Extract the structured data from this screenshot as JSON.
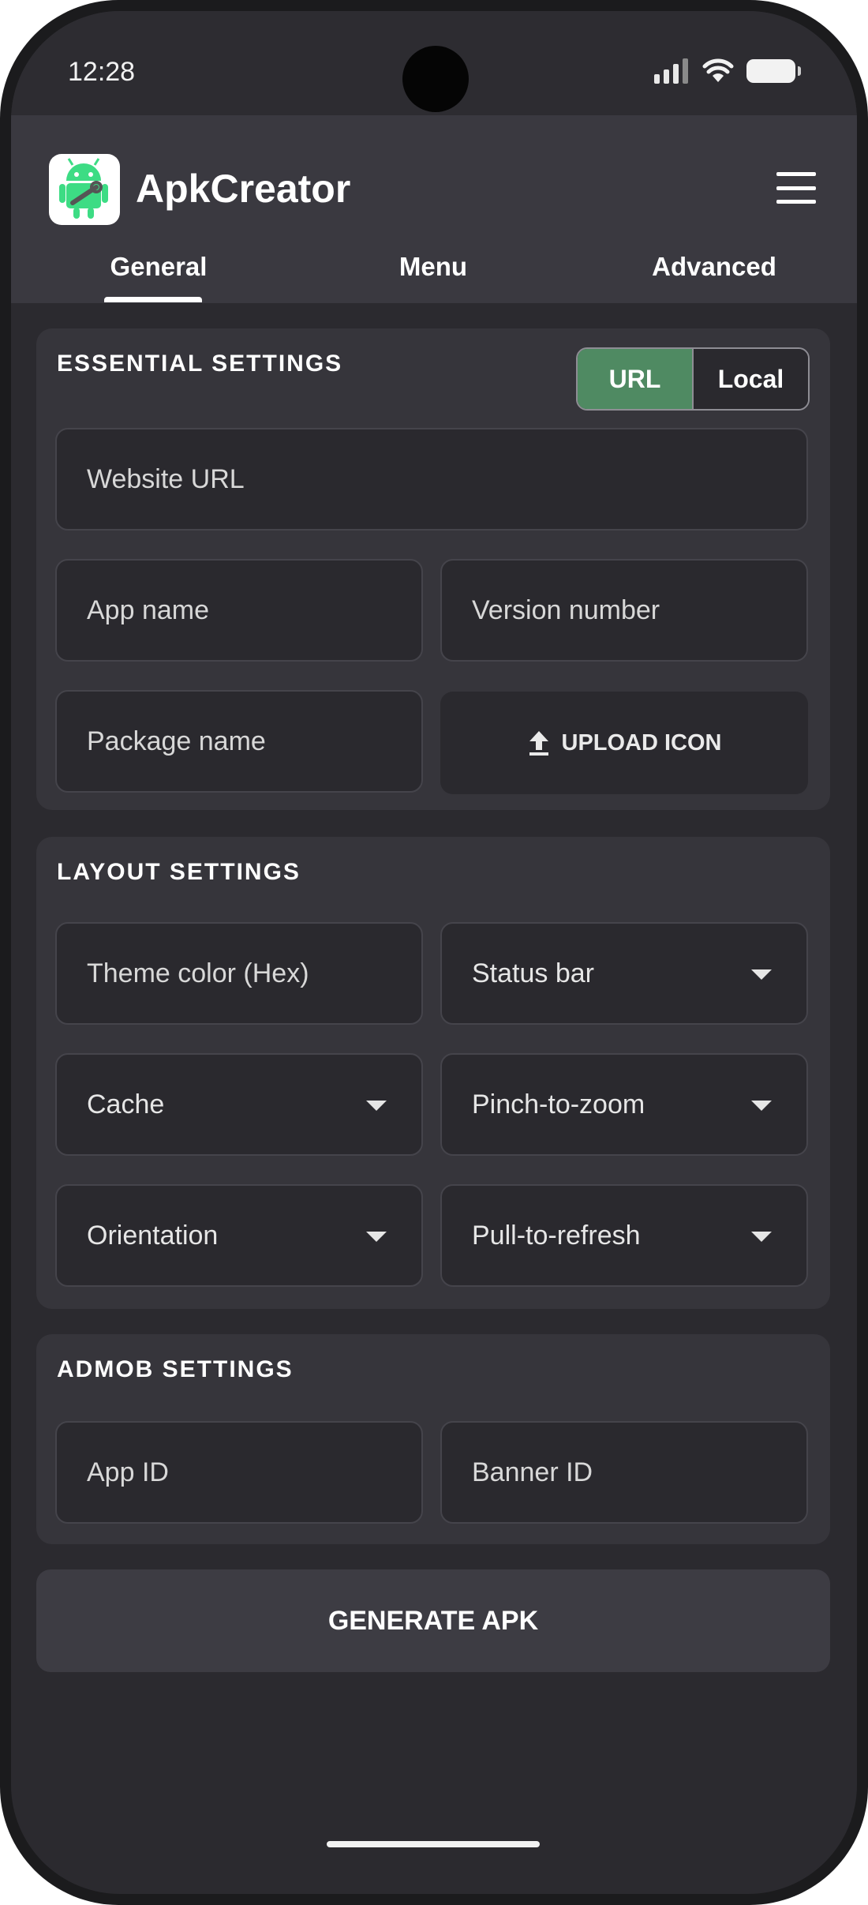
{
  "status_bar": {
    "time": "12:28"
  },
  "app": {
    "title": "ApkCreator"
  },
  "tabs": [
    {
      "label": "General",
      "selected": true
    },
    {
      "label": "Menu",
      "selected": false
    },
    {
      "label": "Advanced",
      "selected": false
    }
  ],
  "essential": {
    "title": "ESSENTIAL SETTINGS",
    "toggle": {
      "options": [
        "URL",
        "Local"
      ],
      "selected": "URL"
    },
    "website_url_placeholder": "Website URL",
    "app_name_placeholder": "App name",
    "version_placeholder": "Version number",
    "package_placeholder": "Package name",
    "upload_label": "UPLOAD ICON"
  },
  "layout": {
    "title": "LAYOUT SETTINGS",
    "theme_color_placeholder": "Theme color (Hex)",
    "status_bar": "Status bar",
    "cache": "Cache",
    "pinch_to_zoom": "Pinch-to-zoom",
    "orientation": "Orientation",
    "pull_to_refresh": "Pull-to-refresh"
  },
  "admob": {
    "title": "ADMOB SETTINGS",
    "app_id_placeholder": "App ID",
    "banner_id_placeholder": "Banner ID"
  },
  "generate_label": "GENERATE APK",
  "colors": {
    "accent_green": "#4f8a62",
    "background": "#2b2a2f",
    "card": "#36353b",
    "app_bar": "#3a3940"
  }
}
